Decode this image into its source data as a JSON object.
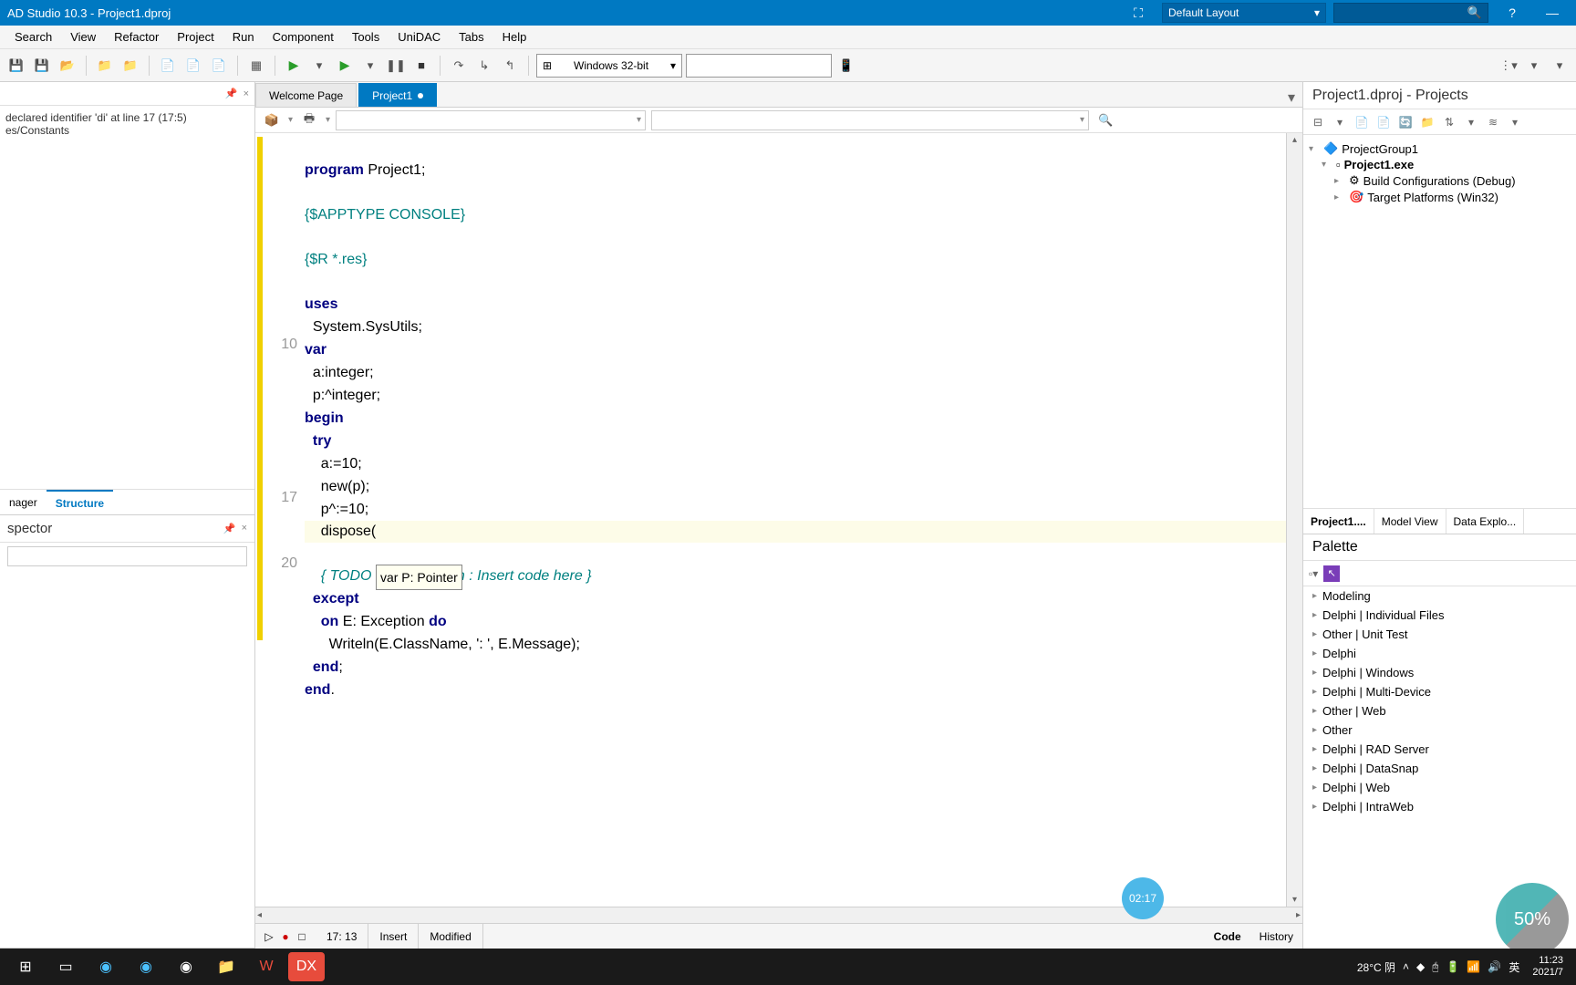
{
  "titlebar": {
    "title": "AD Studio 10.3 - Project1.dproj",
    "layout_dd": "Default Layout",
    "help": "?",
    "minimize": "—"
  },
  "menu": [
    "Search",
    "View",
    "Refactor",
    "Project",
    "Run",
    "Component",
    "Tools",
    "UniDAC",
    "Tabs",
    "Help"
  ],
  "toolbar": {
    "platform": "Windows 32-bit"
  },
  "left": {
    "errors_body": "declared identifier 'di' at line 17 (17:5)\nes/Constants",
    "tabs": {
      "manager": "nager",
      "structure": "Structure"
    },
    "inspector_title": "spector",
    "pin": "📌",
    "close": "×"
  },
  "doc_tabs": {
    "welcome": "Welcome Page",
    "project": "Project1"
  },
  "code": {
    "ln10": "10",
    "ln17": "17",
    "ln20": "20",
    "l1_a": "program",
    "l1_b": " Project1;",
    "l2": "{$APPTYPE CONSOLE}",
    "l3": "{$R *.res}",
    "l4": "uses",
    "l5": "  System.SysUtils;",
    "l6": "var",
    "l7": "  a:integer;",
    "l8": "  p:^integer;",
    "l9": "begin",
    "l10": "  try",
    "l11": "    a:=10;",
    "l12": "    new(p);",
    "l13": "    p^:=10;",
    "l14": "    dispose(",
    "l15a": "    { TODO ",
    "l15c": "Console Main : Insert code here }",
    "l16": "  except",
    "l17a": "    on ",
    "l17b": "E: Exception ",
    "l17c": "do",
    "l18": "      Writeln(E.ClassName, ': ', E.Message);",
    "l19": "  end;",
    "l20": "end.",
    "tooltip": "var P: Pointer"
  },
  "status": {
    "pos": "17: 13",
    "mode": "Insert",
    "state": "Modified",
    "code_tab": "Code",
    "history_tab": "History"
  },
  "projects": {
    "title": "Project1.dproj - Projects",
    "group": "ProjectGroup1",
    "exe": "Project1.exe",
    "build": "Build Configurations (Debug)",
    "target": "Target Platforms (Win32)",
    "tabs": {
      "p": "Project1....",
      "m": "Model View",
      "d": "Data Explo..."
    }
  },
  "palette": {
    "title": "Palette",
    "items": [
      "Modeling",
      "Delphi | Individual Files",
      "Other | Unit Test",
      "Delphi",
      "Delphi | Windows",
      "Delphi | Multi-Device",
      "Other | Web",
      "Other",
      "Delphi | RAD Server",
      "Delphi | DataSnap",
      "Delphi | Web",
      "Delphi | IntraWeb"
    ]
  },
  "overlay": {
    "timer": "02:17",
    "zoom": "50%"
  },
  "taskbar": {
    "weather": "28°C 阴",
    "ime": "英",
    "time": "11:23",
    "date": "2021/7"
  }
}
